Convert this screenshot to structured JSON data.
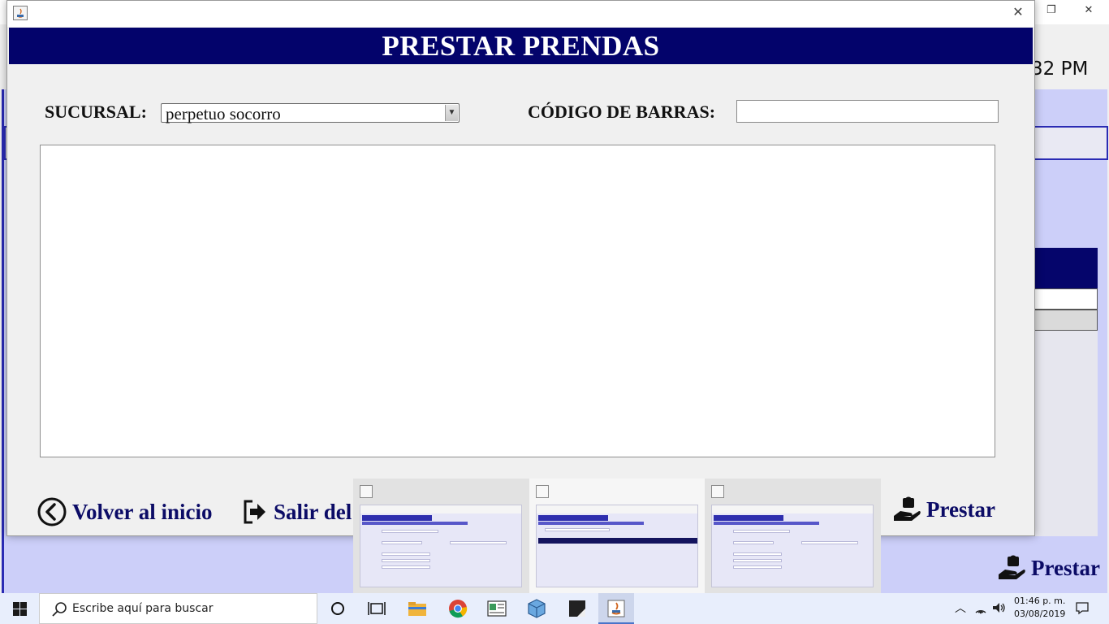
{
  "background_window": {
    "clock_fragment": "32 PM",
    "prestar_label": "Prestar"
  },
  "dialog": {
    "title": "PRESTAR PRENDAS",
    "sucursal": {
      "label": "SUCURSAL:",
      "selected": "perpetuo socorro"
    },
    "barcode": {
      "label": "CÓDIGO DE BARRAS:",
      "value": ""
    },
    "buttons": {
      "volver": "Volver al inicio",
      "salir": "Salir del",
      "prestar": "Prestar"
    }
  },
  "taskbar": {
    "search_placeholder": "Escribe aquí para buscar",
    "time": "01:46 p. m.",
    "date": "03/08/2019"
  },
  "colors": {
    "header_navy": "#03036b",
    "button_text": "#0b0b66",
    "background_panel": "#cccff9"
  }
}
